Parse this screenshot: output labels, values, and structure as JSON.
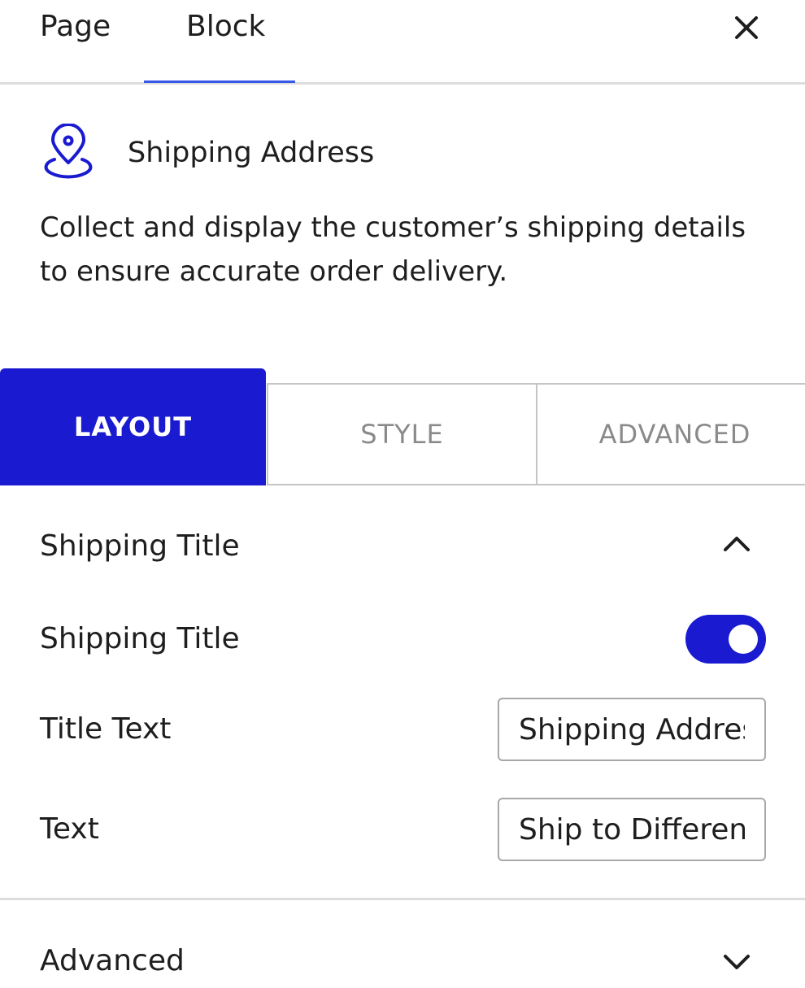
{
  "top_tabs": {
    "page_label": "Page",
    "block_label": "Block",
    "active": "Block"
  },
  "close_icon": "close-icon",
  "block": {
    "icon": "map-pin-icon",
    "title": "Shipping Address",
    "description": "Collect and display the customer’s shipping details to ensure accurate order delivery."
  },
  "panel_tabs": {
    "layout": "LAYOUT",
    "style": "STYLE",
    "advanced": "ADVANCED",
    "active": "LAYOUT"
  },
  "section": {
    "title": "Shipping Title",
    "expanded": true,
    "toggle_label": "Shipping Title",
    "toggle_on": true,
    "title_text_label": "Title Text",
    "title_text_value": "Shipping Address",
    "text_label": "Text",
    "text_value": "Ship to Different Address?"
  },
  "advanced_section": {
    "title": "Advanced",
    "expanded": false
  },
  "colors": {
    "accent": "#1a1ad1",
    "tab_underline": "#3858e9",
    "divider": "#dddddd"
  }
}
